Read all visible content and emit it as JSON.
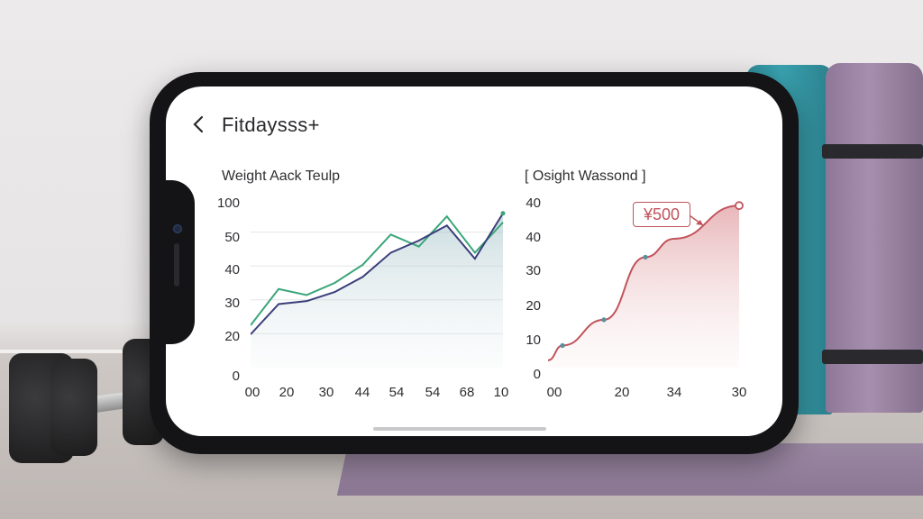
{
  "app": {
    "title": "Fitdaysss+",
    "back_icon": "chevron-left-icon"
  },
  "chart_data": [
    {
      "type": "area",
      "title": "Weight Aack Teulp",
      "y_tick_labels": [
        "100",
        "50",
        "40",
        "30",
        "20",
        "0"
      ],
      "x_tick_labels": [
        "00",
        "20",
        "30",
        "44",
        "54",
        "54",
        "68",
        "10"
      ],
      "series": [
        {
          "values": [
            14,
            26,
            24,
            28,
            34,
            44,
            40,
            50,
            38,
            48
          ],
          "color": "#3aa67a"
        },
        {
          "values": [
            11,
            21,
            22,
            25,
            30,
            38,
            42,
            47,
            36,
            51
          ],
          "color": "#3b3f7a"
        }
      ]
    },
    {
      "type": "area",
      "title": "[ Osight Wassond ]",
      "y_tick_labels": [
        "40",
        "40",
        "30",
        "20",
        "10",
        "0"
      ],
      "x_tick_labels": [
        "00",
        "20",
        "34",
        "30"
      ],
      "annotation": "¥500",
      "series": [
        {
          "values": [
            2,
            6,
            13,
            30,
            35,
            44
          ],
          "color": "#c0545b"
        }
      ]
    }
  ]
}
